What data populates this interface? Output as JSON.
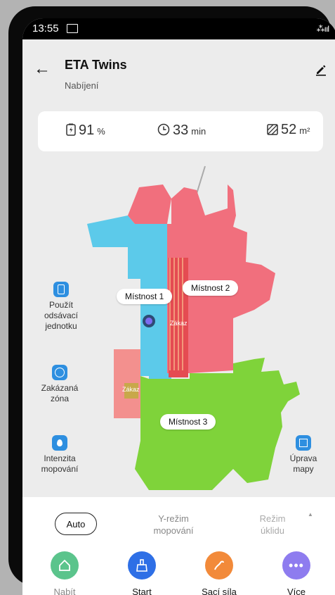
{
  "status_bar": {
    "time": "13:55",
    "signal": "⁂ııl"
  },
  "header": {
    "title": "ETA Twins",
    "subtitle": "Nabíjení"
  },
  "stats": {
    "battery_value": "91",
    "battery_unit": "%",
    "time_value": "33",
    "time_unit": "min",
    "area_value": "52",
    "area_unit": "m²"
  },
  "map": {
    "rooms": [
      "Místnost 1",
      "Místnost 2",
      "Místnost 3"
    ],
    "forbidden_label": "Zákaz"
  },
  "side_tools": {
    "suction": "Použít odsávací jednotku",
    "zone": "Zakázaná zóna",
    "mop": "Intenzita mopování",
    "edit_map": "Úprava mapy"
  },
  "modes": {
    "auto": "Auto",
    "y_mode_1": "Y-režim",
    "y_mode_2": "mopování",
    "clean_mode_1": "Režim",
    "clean_mode_2": "úklidu"
  },
  "actions": {
    "charge": "Nabít",
    "start": "Start",
    "suction_power": "Sací síla",
    "more": "Více"
  },
  "colors": {
    "room1": "#5ccaea",
    "room2": "#f16f7d",
    "room3": "#7fd33a",
    "charge_btn": "#5bc48c",
    "start_btn": "#2e6fe6",
    "suction_btn": "#f28a3a",
    "more_btn": "#8e7cef"
  }
}
